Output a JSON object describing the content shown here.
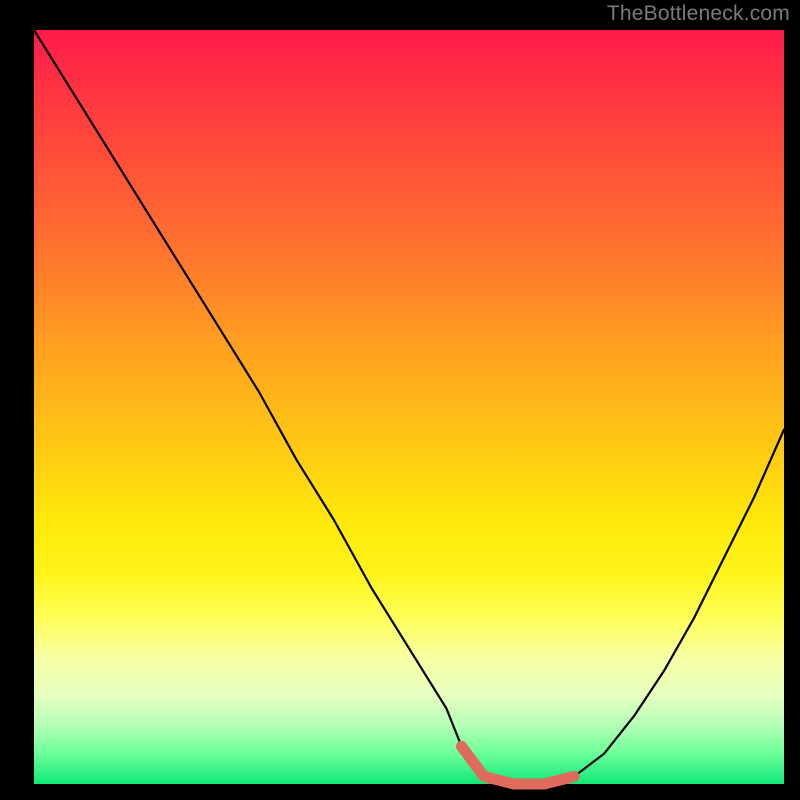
{
  "watermark": "TheBottleneck.com",
  "chart_data": {
    "type": "line",
    "title": "",
    "xlabel": "",
    "ylabel": "",
    "xlim": [
      0,
      100
    ],
    "ylim": [
      0,
      100
    ],
    "series": [
      {
        "name": "main-curve",
        "x": [
          0,
          5,
          10,
          15,
          20,
          25,
          30,
          35,
          40,
          45,
          50,
          55,
          57,
          60,
          64,
          68,
          72,
          76,
          80,
          84,
          88,
          92,
          96,
          100
        ],
        "values": [
          100,
          92,
          84,
          76,
          68,
          60,
          52,
          43,
          35,
          26,
          18,
          10,
          5,
          1,
          0,
          0,
          1,
          4,
          9,
          15,
          22,
          30,
          38,
          47
        ]
      },
      {
        "name": "highlight-segment",
        "x": [
          57,
          60,
          64,
          68,
          72
        ],
        "values": [
          5,
          1,
          0,
          0,
          1
        ]
      }
    ],
    "background_gradient": {
      "top": "#ff1a4a",
      "mid": "#ffe80a",
      "bottom": "#10e878"
    },
    "highlight_color": "#e06a5b"
  }
}
